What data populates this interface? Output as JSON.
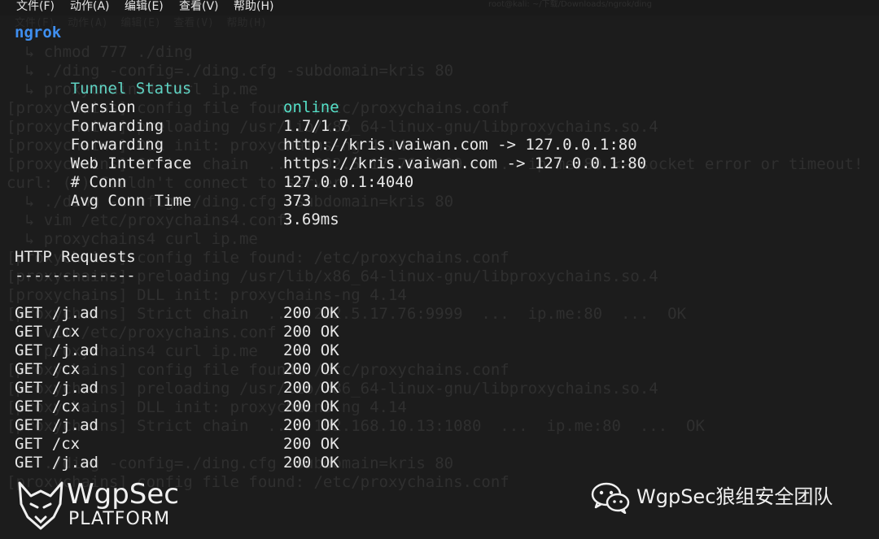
{
  "menubar": {
    "items": [
      "文件(F)",
      "动作(A)",
      "编辑(E)",
      "查看(V)",
      "帮助(H)"
    ],
    "ghost_title": "root@kali: ~/下载/Downloads/ngrok/ding"
  },
  "background_terminal": {
    "lines": [
      "文件(F)  动作(A)  编辑(E)  查看(V)  帮助(H)",
      "  ↳ chmod 777 ./ding",
      "  ↳ ./ding -config=./ding.cfg -subdomain=kris 80",
      "  ↳ proxychains4 curl ip.me",
      "[proxychains] config file found: /etc/proxychains.conf",
      "[proxychains] preloading /usr/lib/x86_64-linux-gnu/libproxychains.so.4",
      "[proxychains] DLL init: proxychains-ng 4.14",
      "[proxychains] Strict chain  ...  202.5.17.76:9999  ...  ip.me:80 <--socket error or timeout!",
      "curl: (7) Couldn't connect to server",
      "  ↳ ./ding -config=./ding.cfg -subdomain=kris 80",
      "  ↳ vim /etc/proxychains4.conf",
      "  ↳ proxychains4 curl ip.me",
      "[proxychains] config file found: /etc/proxychains.conf",
      "[proxychains] preloading /usr/lib/x86_64-linux-gnu/libproxychains.so.4",
      "[proxychains] DLL init: proxychains-ng 4.14",
      "[proxychains] Strict chain  ...  202.5.17.76:9999  ...  ip.me:80  ...  OK",
      "  ↳ vim /etc/proxychains.conf",
      "  ↳ proxychains4 curl ip.me",
      "[proxychains] config file found: /etc/proxychains.conf",
      "[proxychains] preloading /usr/lib/x86_64-linux-gnu/libproxychains.so.4",
      "[proxychains] DLL init: proxychains-ng 4.14",
      "[proxychains] Strict chain  ...  192.168.10.13:1080  ...  ip.me:80  ...  OK",
      "",
      "  ↳ ./ding -config=./ding.cfg -subdomain=kris 80",
      "[proxychains] config file found: /etc/proxychains.conf"
    ]
  },
  "ngrok": {
    "app_name": "ngrok",
    "info": [
      {
        "label": "Tunnel Status",
        "value": "online"
      },
      {
        "label": "Version",
        "value": "1.7/1.7"
      },
      {
        "label": "Forwarding",
        "value": "http://kris.vaiwan.com -> 127.0.0.1:80"
      },
      {
        "label": "Forwarding",
        "value": "https://kris.vaiwan.com -> 127.0.0.1:80"
      },
      {
        "label": "Web Interface",
        "value": "127.0.0.1:4040"
      },
      {
        "label": "# Conn",
        "value": "373"
      },
      {
        "label": "Avg Conn Time",
        "value": "3.69ms"
      }
    ],
    "requests_title": "HTTP Requests",
    "requests_rule": "-------------",
    "requests": [
      {
        "request": "GET /j.ad",
        "status": "200 OK"
      },
      {
        "request": "GET /cx",
        "status": "200 OK"
      },
      {
        "request": "GET /j.ad",
        "status": "200 OK"
      },
      {
        "request": "GET /cx",
        "status": "200 OK"
      },
      {
        "request": "GET /j.ad",
        "status": "200 OK"
      },
      {
        "request": "GET /cx",
        "status": "200 OK"
      },
      {
        "request": "GET /j.ad",
        "status": "200 OK"
      },
      {
        "request": "GET /cx",
        "status": "200 OK"
      },
      {
        "request": "GET /j.ad",
        "status": "200 OK"
      }
    ]
  },
  "watermark": {
    "logo_top": "WgpSec",
    "logo_bottom": "PLATFORM",
    "wechat_label": "WgpSec狼组安全团队",
    "icon": "wolf-head-icon",
    "wechat_icon": "wechat-icon"
  },
  "colors": {
    "background": "#1c1c1c",
    "foreground": "#e8e8e8",
    "app_name": "#3f8ff0",
    "status": "#55e0c8",
    "ghost_text": "#2f2f2f"
  }
}
